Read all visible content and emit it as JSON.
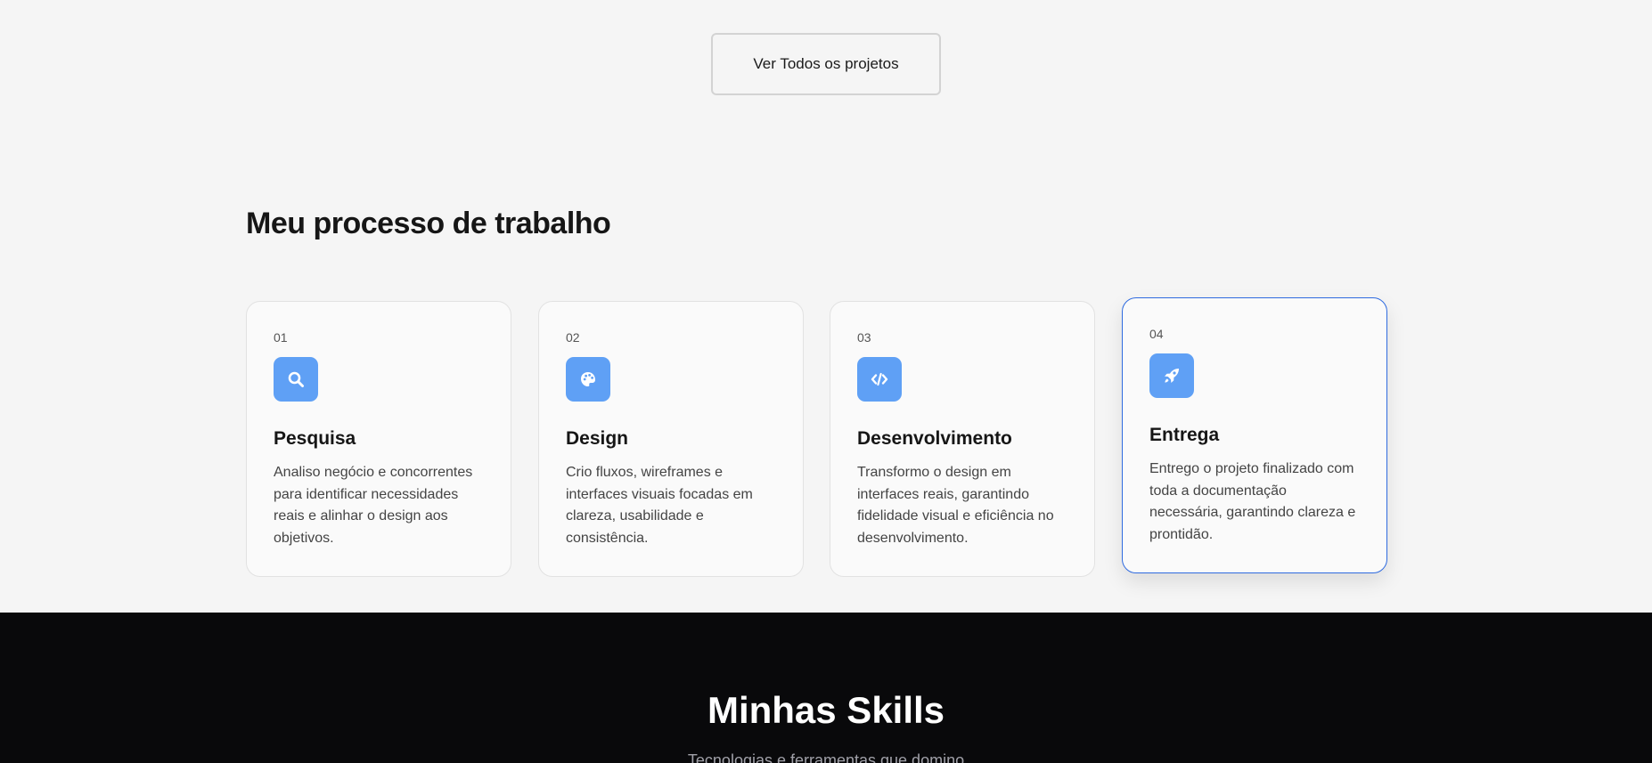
{
  "top": {
    "view_all_label": "Ver Todos os projetos"
  },
  "process": {
    "title": "Meu processo de trabalho",
    "steps": [
      {
        "number": "01",
        "icon": "search-icon",
        "title": "Pesquisa",
        "description": "Analiso negócio e concorrentes para identificar necessidades reais e alinhar o design aos objetivos."
      },
      {
        "number": "02",
        "icon": "palette-icon",
        "title": "Design",
        "description": "Crio fluxos, wireframes e interfaces visuais focadas em clareza, usabilidade e consistência."
      },
      {
        "number": "03",
        "icon": "code-icon",
        "title": "Desenvolvimento",
        "description": "Transformo o design em interfaces reais, garantindo fidelidade visual e eficiência no desenvolvimento."
      },
      {
        "number": "04",
        "icon": "rocket-icon",
        "title": "Entrega",
        "description": "Entrego o projeto finalizado com toda a documentação necessária, garantindo clareza e prontidão."
      }
    ]
  },
  "skills": {
    "title": "Minhas Skills",
    "subtitle": "Tecnologias e ferramentas que domino"
  },
  "colors": {
    "accent": "#5fa0f5",
    "active_border": "#2f6be0",
    "page_bg": "#f5f5f5",
    "dark_bg": "#09090b"
  }
}
